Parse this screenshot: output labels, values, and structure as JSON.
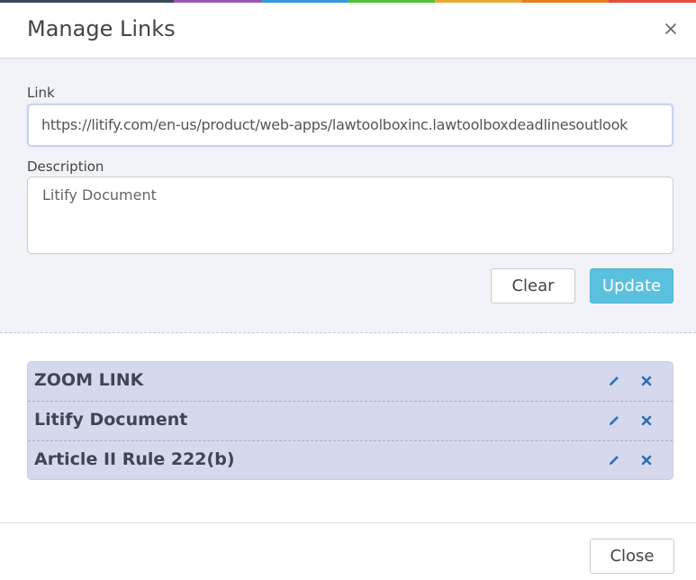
{
  "theme": {
    "rainbow": [
      "#3b4a5a",
      "#3b4a5a",
      "#9b59b6",
      "#3498db",
      "#55c03a",
      "#e8a93a",
      "#e67e22",
      "#e74c3c"
    ],
    "update_button_color": "#5bc0de",
    "list_background": "#d6d9ee"
  },
  "dialog": {
    "title": "Manage Links",
    "close_icon": "close-icon"
  },
  "form": {
    "link_label": "Link",
    "link_value": "https://litify.com/en-us/product/web-apps/lawtoolboxinc.lawtoolboxdeadlinesoutlook",
    "description_label": "Description",
    "description_value": "Litify Document",
    "clear_label": "Clear",
    "update_label": "Update"
  },
  "links": [
    {
      "title": "ZOOM LINK",
      "edit_icon": "pencil-icon",
      "delete_icon": "close-icon"
    },
    {
      "title": "Litify Document",
      "edit_icon": "pencil-icon",
      "delete_icon": "close-icon"
    },
    {
      "title": "Article II Rule 222(b)",
      "edit_icon": "pencil-icon",
      "delete_icon": "close-icon"
    }
  ],
  "footer": {
    "close_label": "Close"
  }
}
